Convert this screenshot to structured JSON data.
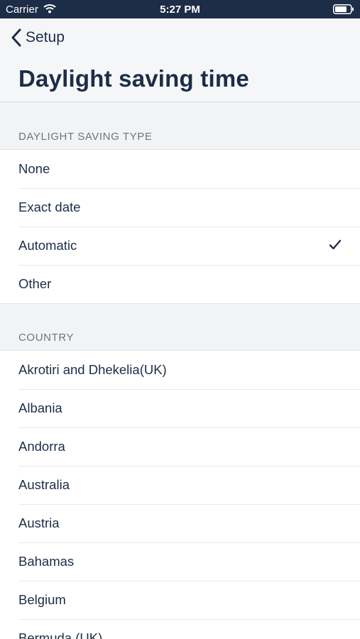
{
  "status_bar": {
    "carrier": "Carrier",
    "time": "5:27 PM"
  },
  "nav": {
    "back_label": "Setup",
    "title": "Daylight saving time"
  },
  "dst_section": {
    "header": "DAYLIGHT SAVING TYPE",
    "items": [
      {
        "label": "None",
        "selected": false
      },
      {
        "label": "Exact date",
        "selected": false
      },
      {
        "label": "Automatic",
        "selected": true
      },
      {
        "label": "Other",
        "selected": false
      }
    ]
  },
  "country_section": {
    "header": "COUNTRY",
    "items": [
      {
        "label": "Akrotiri and Dhekelia(UK)"
      },
      {
        "label": "Albania"
      },
      {
        "label": "Andorra"
      },
      {
        "label": "Australia"
      },
      {
        "label": "Austria"
      },
      {
        "label": "Bahamas"
      },
      {
        "label": "Belgium"
      },
      {
        "label": "Bermuda (UK)"
      }
    ]
  },
  "colors": {
    "navy": "#1d2d47",
    "background": "#f2f3f5",
    "section_text": "#6d7480"
  },
  "icons": {
    "back": "chevron-left-icon",
    "check": "checkmark-icon",
    "wifi": "wifi-icon",
    "battery": "battery-icon"
  }
}
